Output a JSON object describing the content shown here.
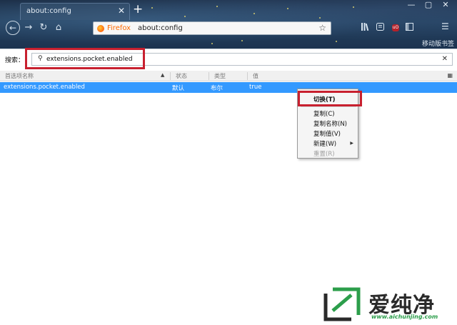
{
  "browser": {
    "tab_title": "about:config",
    "tab_close": "✕",
    "new_tab": "+",
    "window_controls": {
      "minimize": "—",
      "restore": "▢",
      "close": "✕"
    },
    "nav": {
      "back": "←",
      "forward": "→",
      "reload": "↻",
      "home": "⌂"
    },
    "identity_label": "Firefox",
    "url": "about:config",
    "bookmark_star": "☆",
    "toolbar_icons": [
      "library-icon",
      "reader-view-icon",
      "ublock-icon",
      "sidebar-icon",
      "menu-icon"
    ],
    "ublock_label": "uO",
    "menu_glyph": "☰",
    "mobile_bookmarks": "移动版书签"
  },
  "config": {
    "search_label": "搜索：",
    "search_value": "extensions.pocket.enabled",
    "search_clear": "✕",
    "columns": {
      "name": "首选项名称",
      "status": "状态",
      "type": "类型",
      "value": "值"
    },
    "rows": [
      {
        "name": "extensions.pocket.enabled",
        "status": "默认",
        "type": "布尔",
        "value": "true",
        "selected": true
      }
    ]
  },
  "context_menu": {
    "toggle": "切换(T)",
    "copy": "复制(C)",
    "copy_name": "复制名称(N)",
    "copy_value": "复制值(V)",
    "new": "新建(W)",
    "reset": "重置(R)",
    "reset_disabled": true
  },
  "watermark": {
    "brand": "爱纯净",
    "url": "www.aichunjing.com"
  },
  "colors": {
    "selection": "#3399ff",
    "highlight_box": "#c8202f",
    "watermark_green": "#2c9e4b"
  }
}
